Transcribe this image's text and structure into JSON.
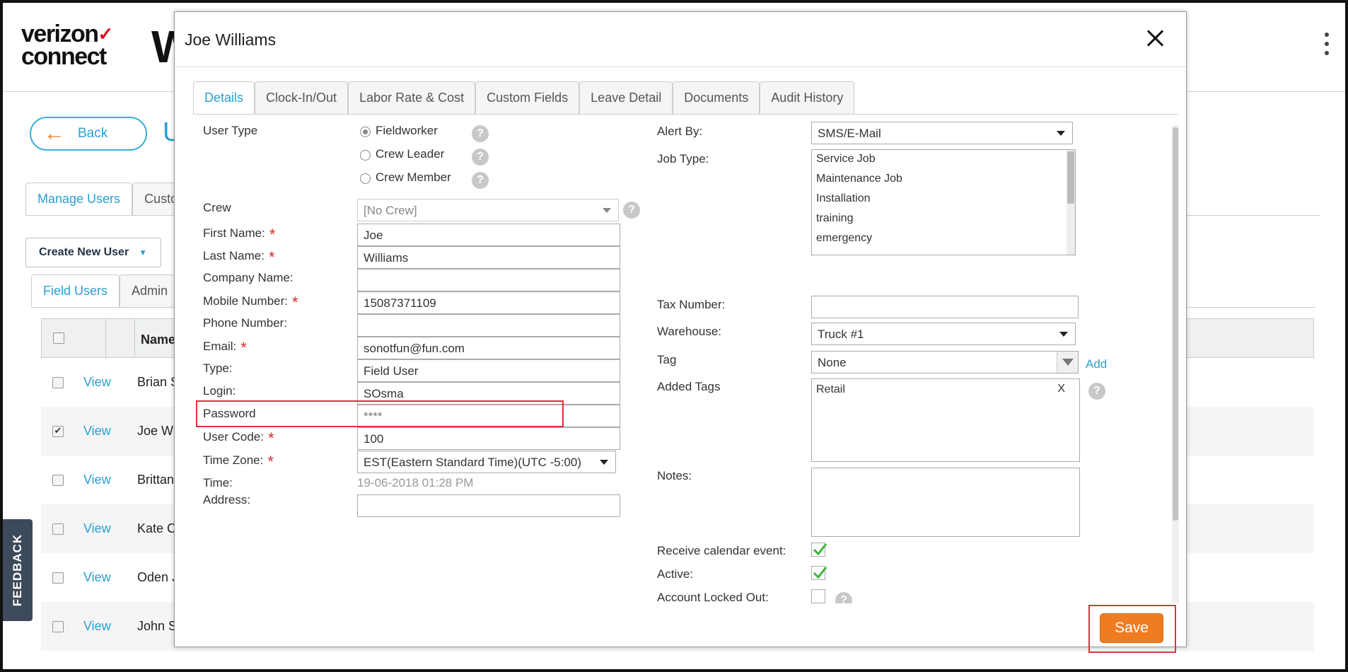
{
  "app": {
    "logo_line1": "verizon",
    "logo_tick": "✓",
    "logo_line2": "connect",
    "logo_partial": "W",
    "back_label": "Back",
    "title_partial": "U",
    "top_tabs": [
      "Manage Users",
      "Custo"
    ],
    "create_user_label": "Create New User",
    "user_tabs": [
      "Field Users",
      "Admin"
    ],
    "table_header_name": "Name",
    "rows": [
      {
        "view": "View",
        "name": "Brian S",
        "checked": false
      },
      {
        "view": "View",
        "name": "Joe Wi",
        "checked": true
      },
      {
        "view": "View",
        "name": "Brittany",
        "checked": false
      },
      {
        "view": "View",
        "name": "Kate C",
        "checked": false
      },
      {
        "view": "View",
        "name": "Oden J",
        "checked": false
      },
      {
        "view": "View",
        "name": "John S",
        "checked": false
      }
    ],
    "feedback_label": "FEEDBACK"
  },
  "modal": {
    "title": "Joe Williams",
    "tabs": [
      "Details",
      "Clock-In/Out",
      "Labor Rate & Cost",
      "Custom Fields",
      "Leave Detail",
      "Documents",
      "Audit History"
    ],
    "active_tab": "Details",
    "save_label": "Save",
    "left": {
      "user_type_label": "User Type",
      "user_type_options": [
        "Fieldworker",
        "Crew Leader",
        "Crew Member"
      ],
      "user_type_selected": "Fieldworker",
      "crew_label": "Crew",
      "crew_value": "[No Crew]",
      "first_name_label": "First Name:",
      "first_name_value": "Joe",
      "last_name_label": "Last Name:",
      "last_name_value": "Williams",
      "company_label": "Company Name:",
      "company_value": "",
      "mobile_label": "Mobile Number:",
      "mobile_value": "15087371109",
      "phone_label": "Phone Number:",
      "phone_value": "",
      "email_label": "Email:",
      "email_value": "sonotfun@fun.com",
      "type_label": "Type:",
      "type_value": "Field User",
      "login_label": "Login:",
      "login_value": "SOsma",
      "password_label": "Password",
      "password_value": "****",
      "user_code_label": "User Code:",
      "user_code_value": "100",
      "time_zone_label": "Time Zone:",
      "time_zone_value": "EST(Eastern Standard Time)(UTC -5:00)",
      "time_label": "Time:",
      "time_value": "19-06-2018 01:28 PM",
      "address_label": "Address:",
      "required_mark": "*",
      "help_mark": "?"
    },
    "right": {
      "alert_by_label": "Alert By:",
      "alert_by_value": "SMS/E-Mail",
      "job_type_label": "Job Type:",
      "job_types": [
        "Service Job",
        "Maintenance Job",
        "Installation",
        "training",
        "emergency"
      ],
      "tax_label": "Tax Number:",
      "tax_value": "",
      "warehouse_label": "Warehouse:",
      "warehouse_value": "Truck #1",
      "tag_label": "Tag",
      "tag_value": "None",
      "add_label": "Add",
      "added_tags_label": "Added Tags",
      "added_tags": [
        "Retail"
      ],
      "remove_tag_label": "X",
      "notes_label": "Notes:",
      "notes_value": "",
      "calendar_label": "Receive calendar event:",
      "calendar_checked": true,
      "active_label": "Active:",
      "active_checked": true,
      "locked_label": "Account Locked Out:",
      "locked_checked": false
    }
  },
  "colors": {
    "accent_blue": "#2a9fd4",
    "save_orange": "#f07c22",
    "highlight_red": "#e0313a",
    "required_red": "#d72a2a",
    "check_green": "#3bb33b"
  }
}
